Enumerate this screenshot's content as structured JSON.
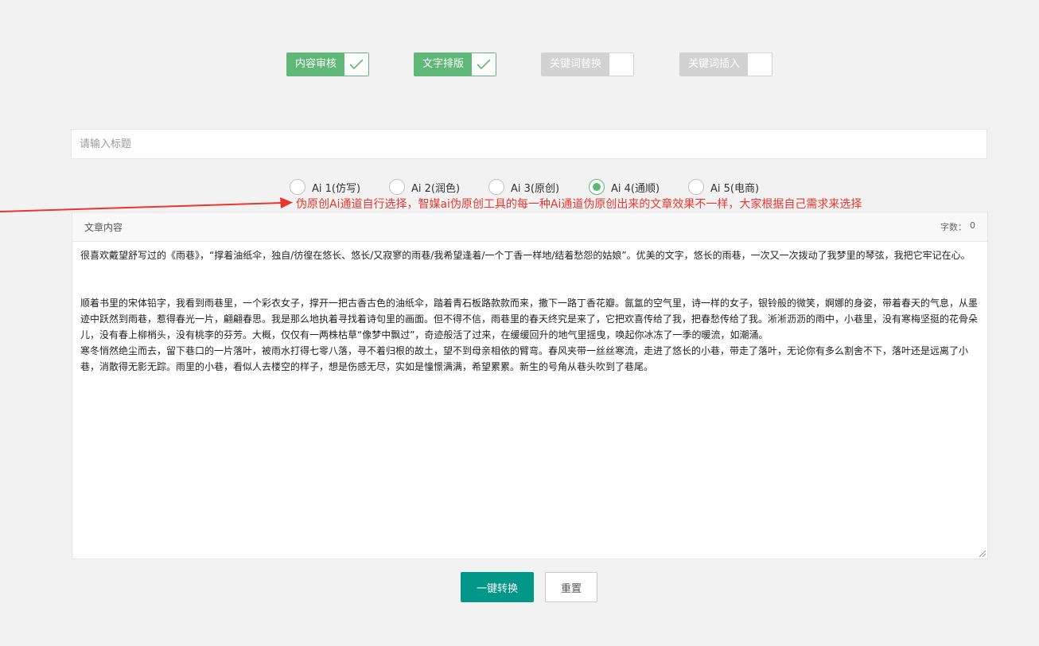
{
  "toggles": [
    {
      "label": "内容审核",
      "checked": true
    },
    {
      "label": "文字排版",
      "checked": true
    },
    {
      "label": "关键词替换",
      "checked": false
    },
    {
      "label": "关键词插入",
      "checked": false
    }
  ],
  "title_input": {
    "placeholder": "请输入标题",
    "value": ""
  },
  "radios": [
    {
      "label": "Ai 1(仿写)",
      "checked": false
    },
    {
      "label": "Ai 2(润色)",
      "checked": false
    },
    {
      "label": "Ai 3(原创)",
      "checked": false
    },
    {
      "label": "Ai 4(通顺)",
      "checked": true
    },
    {
      "label": "Ai 5(电商)",
      "checked": false
    }
  ],
  "annotation": "伪原创Ai通道自行选择，智媒ai伪原创工具的每一种Ai通道伪原创出来的文章效果不一样，大家根据自己需求来选择",
  "content_panel": {
    "title": "文章内容",
    "wordcount_label": "字数：",
    "wordcount_value": "0",
    "paragraphs": [
      "很喜欢戴望舒写过的《雨巷》，“撑着油纸伞，独自/彷徨在悠长、悠长/又寂寥的雨巷/我希望逢着/一个丁香一样地/结着愁怨的姑娘”。优美的文字，悠长的雨巷，一次又一次拨动了我梦里的琴弦，我把它牢记在心。",
      "顺着书里的宋体铅字，我看到雨巷里，一个彩衣女子，撑开一把古香古色的油纸伞，踏着青石板路款款而来，撒下一路丁香花瓣。氤氲的空气里，诗一样的女子，银铃般的微笑，婀娜的身姿，带着春天的气息，从墨迹中跃然到雨巷，惹得春光一片，翩翩春思。我是那么地执着寻找着诗句里的画面。但不得不信，雨巷里的春天终究是来了，它把欢喜传给了我，把春愁传给了我。淅淅沥沥的雨中，小巷里，没有寒梅坚挺的花骨朵儿，没有春上柳梢头，没有桃李的芬芳。大概，仅仅有一两株枯草“像梦中飘过”，奇迹般活了过来，在缓缓回升的地气里摇曳，唤起你冰冻了一季的暖流，如潮涌。",
      "寒冬悄然绝尘而去，留下巷口的一片落叶，被雨水打得七零八落，寻不着归根的故土，望不到母亲相依的臂弯。春风夹带一丝丝寒流，走进了悠长的小巷，带走了落叶，无论你有多么割舍不下，落叶还是远离了小巷，消散得无影无踪。雨里的小巷，看似人去楼空的样子，想是伤感无尽，实如是憧憬满满，希望累累。新生的号角从巷头吹到了巷尾。"
    ]
  },
  "buttons": {
    "convert": "一键转换",
    "reset": "重置"
  },
  "colors": {
    "accent_green": "#5fb878",
    "primary_teal": "#009688",
    "annotation_red": "#e8372f",
    "toggle_off": "#d2d2d2"
  }
}
